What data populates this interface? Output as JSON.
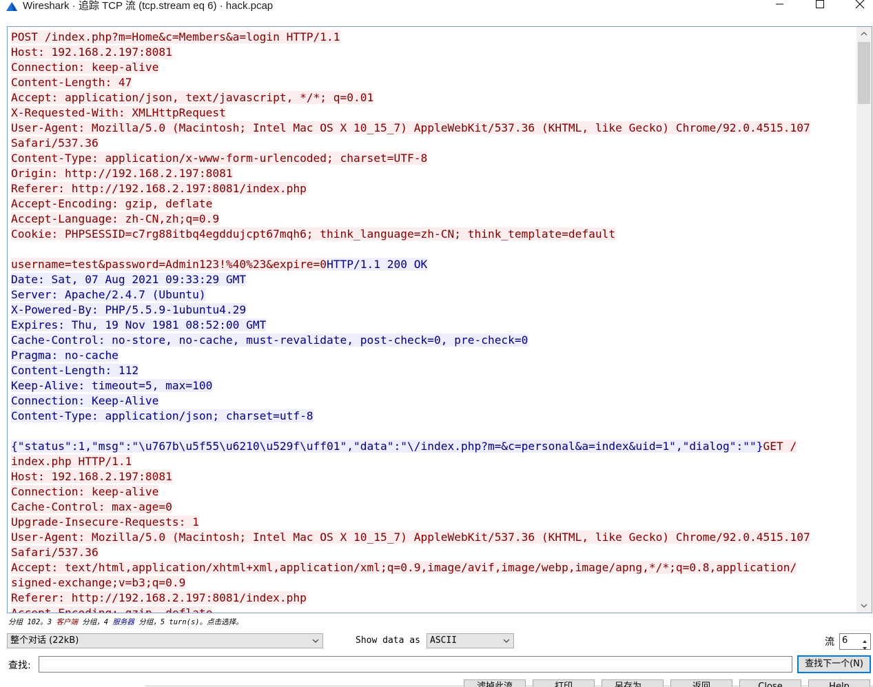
{
  "window": {
    "title": "Wireshark · 追踪 TCP 流 (tcp.stream eq 6) · hack.pcap",
    "icons": [
      "wireshark-fin-icon",
      "minimize-icon",
      "maximize-icon",
      "close-icon"
    ]
  },
  "colors": {
    "client_text": "#7f0000",
    "client_bg": "#fbeded",
    "server_text": "#00007f",
    "server_bg": "#ededfb",
    "accent": "#0078d7"
  },
  "stream_lines": [
    [
      {
        "t": "POST /index.php?m=Home&c=Members&a=login HTTP/1.1",
        "d": "c"
      }
    ],
    [
      {
        "t": "Host: 192.168.2.197:8081",
        "d": "c"
      }
    ],
    [
      {
        "t": "Connection: keep-alive",
        "d": "c"
      }
    ],
    [
      {
        "t": "Content-Length: 47",
        "d": "c"
      }
    ],
    [
      {
        "t": "Accept: application/json, text/javascript, */*; q=0.01",
        "d": "c"
      }
    ],
    [
      {
        "t": "X-Requested-With: XMLHttpRequest",
        "d": "c"
      }
    ],
    [
      {
        "t": "User-Agent: Mozilla/5.0 (Macintosh; Intel Mac OS X 10_15_7) AppleWebKit/537.36 (KHTML, like Gecko) Chrome/92.0.4515.107",
        "d": "c"
      }
    ],
    [
      {
        "t": "Safari/537.36",
        "d": "c"
      }
    ],
    [
      {
        "t": "Content-Type: application/x-www-form-urlencoded; charset=UTF-8",
        "d": "c"
      }
    ],
    [
      {
        "t": "Origin: http://192.168.2.197:8081",
        "d": "c"
      }
    ],
    [
      {
        "t": "Referer: http://192.168.2.197:8081/index.php",
        "d": "c"
      }
    ],
    [
      {
        "t": "Accept-Encoding: gzip, deflate",
        "d": "c"
      }
    ],
    [
      {
        "t": "Accept-Language: zh-CN,zh;q=0.9",
        "d": "c"
      }
    ],
    [
      {
        "t": "Cookie: PHPSESSID=c7rg88itbq4egddujcpt67mqh6; think_language=zh-CN; think_template=default",
        "d": "c"
      }
    ],
    [],
    [
      {
        "t": "username=test&password=Admin123!%40%23&expire=0",
        "d": "c"
      },
      {
        "t": "HTTP/1.1 200 OK",
        "d": "s"
      }
    ],
    [
      {
        "t": "Date: Sat, 07 Aug 2021 09:33:29 GMT",
        "d": "s"
      }
    ],
    [
      {
        "t": "Server: Apache/2.4.7 (Ubuntu)",
        "d": "s"
      }
    ],
    [
      {
        "t": "X-Powered-By: PHP/5.5.9-1ubuntu4.29",
        "d": "s"
      }
    ],
    [
      {
        "t": "Expires: Thu, 19 Nov 1981 08:52:00 GMT",
        "d": "s"
      }
    ],
    [
      {
        "t": "Cache-Control: no-store, no-cache, must-revalidate, post-check=0, pre-check=0",
        "d": "s"
      }
    ],
    [
      {
        "t": "Pragma: no-cache",
        "d": "s"
      }
    ],
    [
      {
        "t": "Content-Length: 112",
        "d": "s"
      }
    ],
    [
      {
        "t": "Keep-Alive: timeout=5, max=100",
        "d": "s"
      }
    ],
    [
      {
        "t": "Connection: Keep-Alive",
        "d": "s"
      }
    ],
    [
      {
        "t": "Content-Type: application/json; charset=utf-8",
        "d": "s"
      }
    ],
    [],
    [
      {
        "t": "{\"status\":1,\"msg\":\"\\u767b\\u5f55\\u6210\\u529f\\uff01\",\"data\":\"\\/index.php?m=&c=personal&a=index&uid=1\",\"dialog\":\"\"}",
        "d": "s"
      },
      {
        "t": "GET /",
        "d": "c"
      }
    ],
    [
      {
        "t": "index.php HTTP/1.1",
        "d": "c"
      }
    ],
    [
      {
        "t": "Host: 192.168.2.197:8081",
        "d": "c"
      }
    ],
    [
      {
        "t": "Connection: keep-alive",
        "d": "c"
      }
    ],
    [
      {
        "t": "Cache-Control: max-age=0",
        "d": "c"
      }
    ],
    [
      {
        "t": "Upgrade-Insecure-Requests: 1",
        "d": "c"
      }
    ],
    [
      {
        "t": "User-Agent: Mozilla/5.0 (Macintosh; Intel Mac OS X 10_15_7) AppleWebKit/537.36 (KHTML, like Gecko) Chrome/92.0.4515.107",
        "d": "c"
      }
    ],
    [
      {
        "t": "Safari/537.36",
        "d": "c"
      }
    ],
    [
      {
        "t": "Accept: text/html,application/xhtml+xml,application/xml;q=0.9,image/avif,image/webp,image/apng,*/*;q=0.8,application/",
        "d": "c"
      }
    ],
    [
      {
        "t": "signed-exchange;v=b3;q=0.9",
        "d": "c"
      }
    ],
    [
      {
        "t": "Referer: http://192.168.2.197:8081/index.php",
        "d": "c"
      }
    ],
    [
      {
        "t": "Accept-Encoding: gzip, deflate",
        "d": "c"
      }
    ]
  ],
  "status": {
    "prefix": "分组 102。3 ",
    "client_word": "客户端",
    "middle": " 分组，4 ",
    "server_word": "服务器",
    "suffix": " 分组，5 turn(s)。点击选择。"
  },
  "controls": {
    "conversation_value": "整个对话 (22kB)",
    "show_data_label": "Show data as",
    "encoding_value": "ASCII",
    "stream_label": "流",
    "stream_value": "6"
  },
  "find": {
    "label": "查找:",
    "value": "",
    "next_button": "查找下一个(N)"
  },
  "bottom_buttons": {
    "filter_out": "滤掉此流",
    "print": "打印",
    "save_as": "另存为…",
    "back": "返回",
    "close": "Close",
    "help": "Help"
  }
}
